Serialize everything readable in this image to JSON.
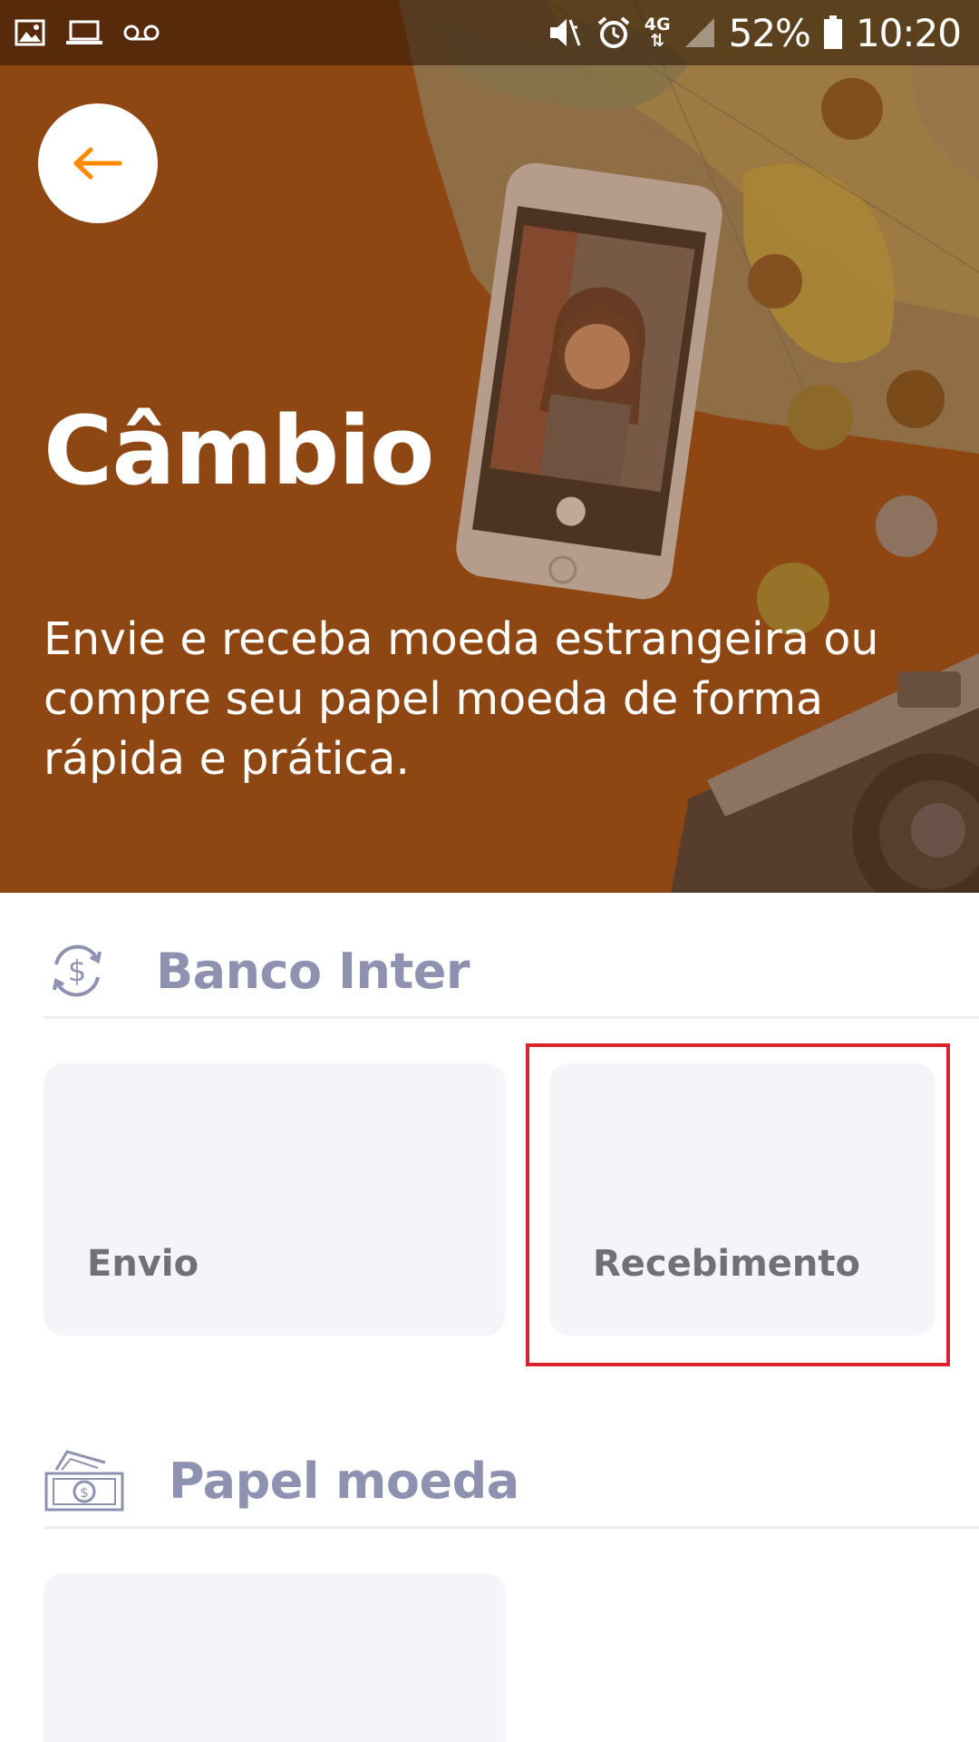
{
  "status_bar": {
    "battery": "52%",
    "time": "10:20",
    "network": "4G",
    "left_icons": [
      "gallery-icon",
      "laptop-icon",
      "voicemail-icon"
    ],
    "right_icons": [
      "mute-icon",
      "alarm-icon",
      "network-4g-icon",
      "signal-icon",
      "battery-icon"
    ]
  },
  "header": {
    "back_icon": "arrow-left-icon",
    "title": "Câmbio",
    "subtitle": "Envie e receba moeda estrangeira ou compre seu papel moeda de forma rápida e prática."
  },
  "sections": [
    {
      "icon": "currency-exchange-icon",
      "title": "Banco Inter",
      "cards": [
        {
          "label": "Envio"
        },
        {
          "label": "Recebimento"
        }
      ]
    },
    {
      "icon": "banknotes-icon",
      "title": "Papel moeda",
      "cards": [
        {
          "label": ""
        }
      ]
    }
  ],
  "colors": {
    "hero_background": "#8e4713",
    "accent_orange": "#ff8a00",
    "section_title": "#8f91b0",
    "card_background": "#f4f5f9",
    "card_label": "#707174",
    "highlight": "#d9232d"
  }
}
